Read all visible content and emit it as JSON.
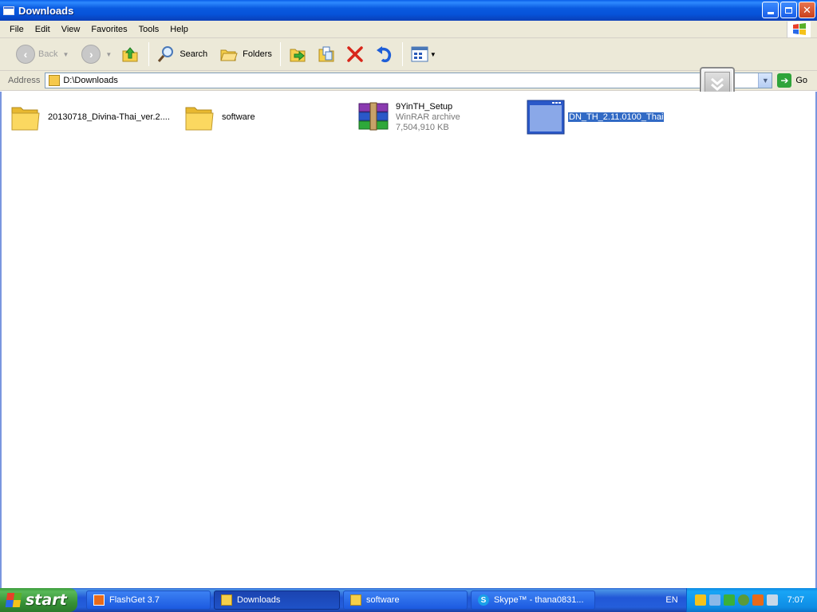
{
  "window": {
    "title": "Downloads"
  },
  "menu": [
    "File",
    "Edit",
    "View",
    "Favorites",
    "Tools",
    "Help"
  ],
  "toolbar": {
    "back": "Back",
    "search": "Search",
    "folders": "Folders"
  },
  "address": {
    "label": "Address",
    "value": "D:\\Downloads",
    "go": "Go"
  },
  "files": [
    {
      "name": "20130718_Divina-Thai_ver.2....",
      "type": "folder"
    },
    {
      "name": "software",
      "type": "folder"
    },
    {
      "name": "9YinTH_Setup",
      "sub1": "WinRAR archive",
      "sub2": "7,504,910 KB",
      "type": "winrar"
    },
    {
      "name": "DN_TH_2.11.0100_Thai",
      "type": "window-app",
      "selected": true
    }
  ],
  "taskbar": {
    "start": "start",
    "tasks": [
      {
        "label": "FlashGet 3.7"
      },
      {
        "label": "Downloads",
        "active": true
      },
      {
        "label": "software"
      },
      {
        "label": "Skype™ - thana0831..."
      }
    ],
    "language": "EN",
    "clock": "7:07"
  },
  "colors": {
    "titlebar": "#0a5ae0",
    "selection": "#316ac5",
    "start": "#379237"
  }
}
